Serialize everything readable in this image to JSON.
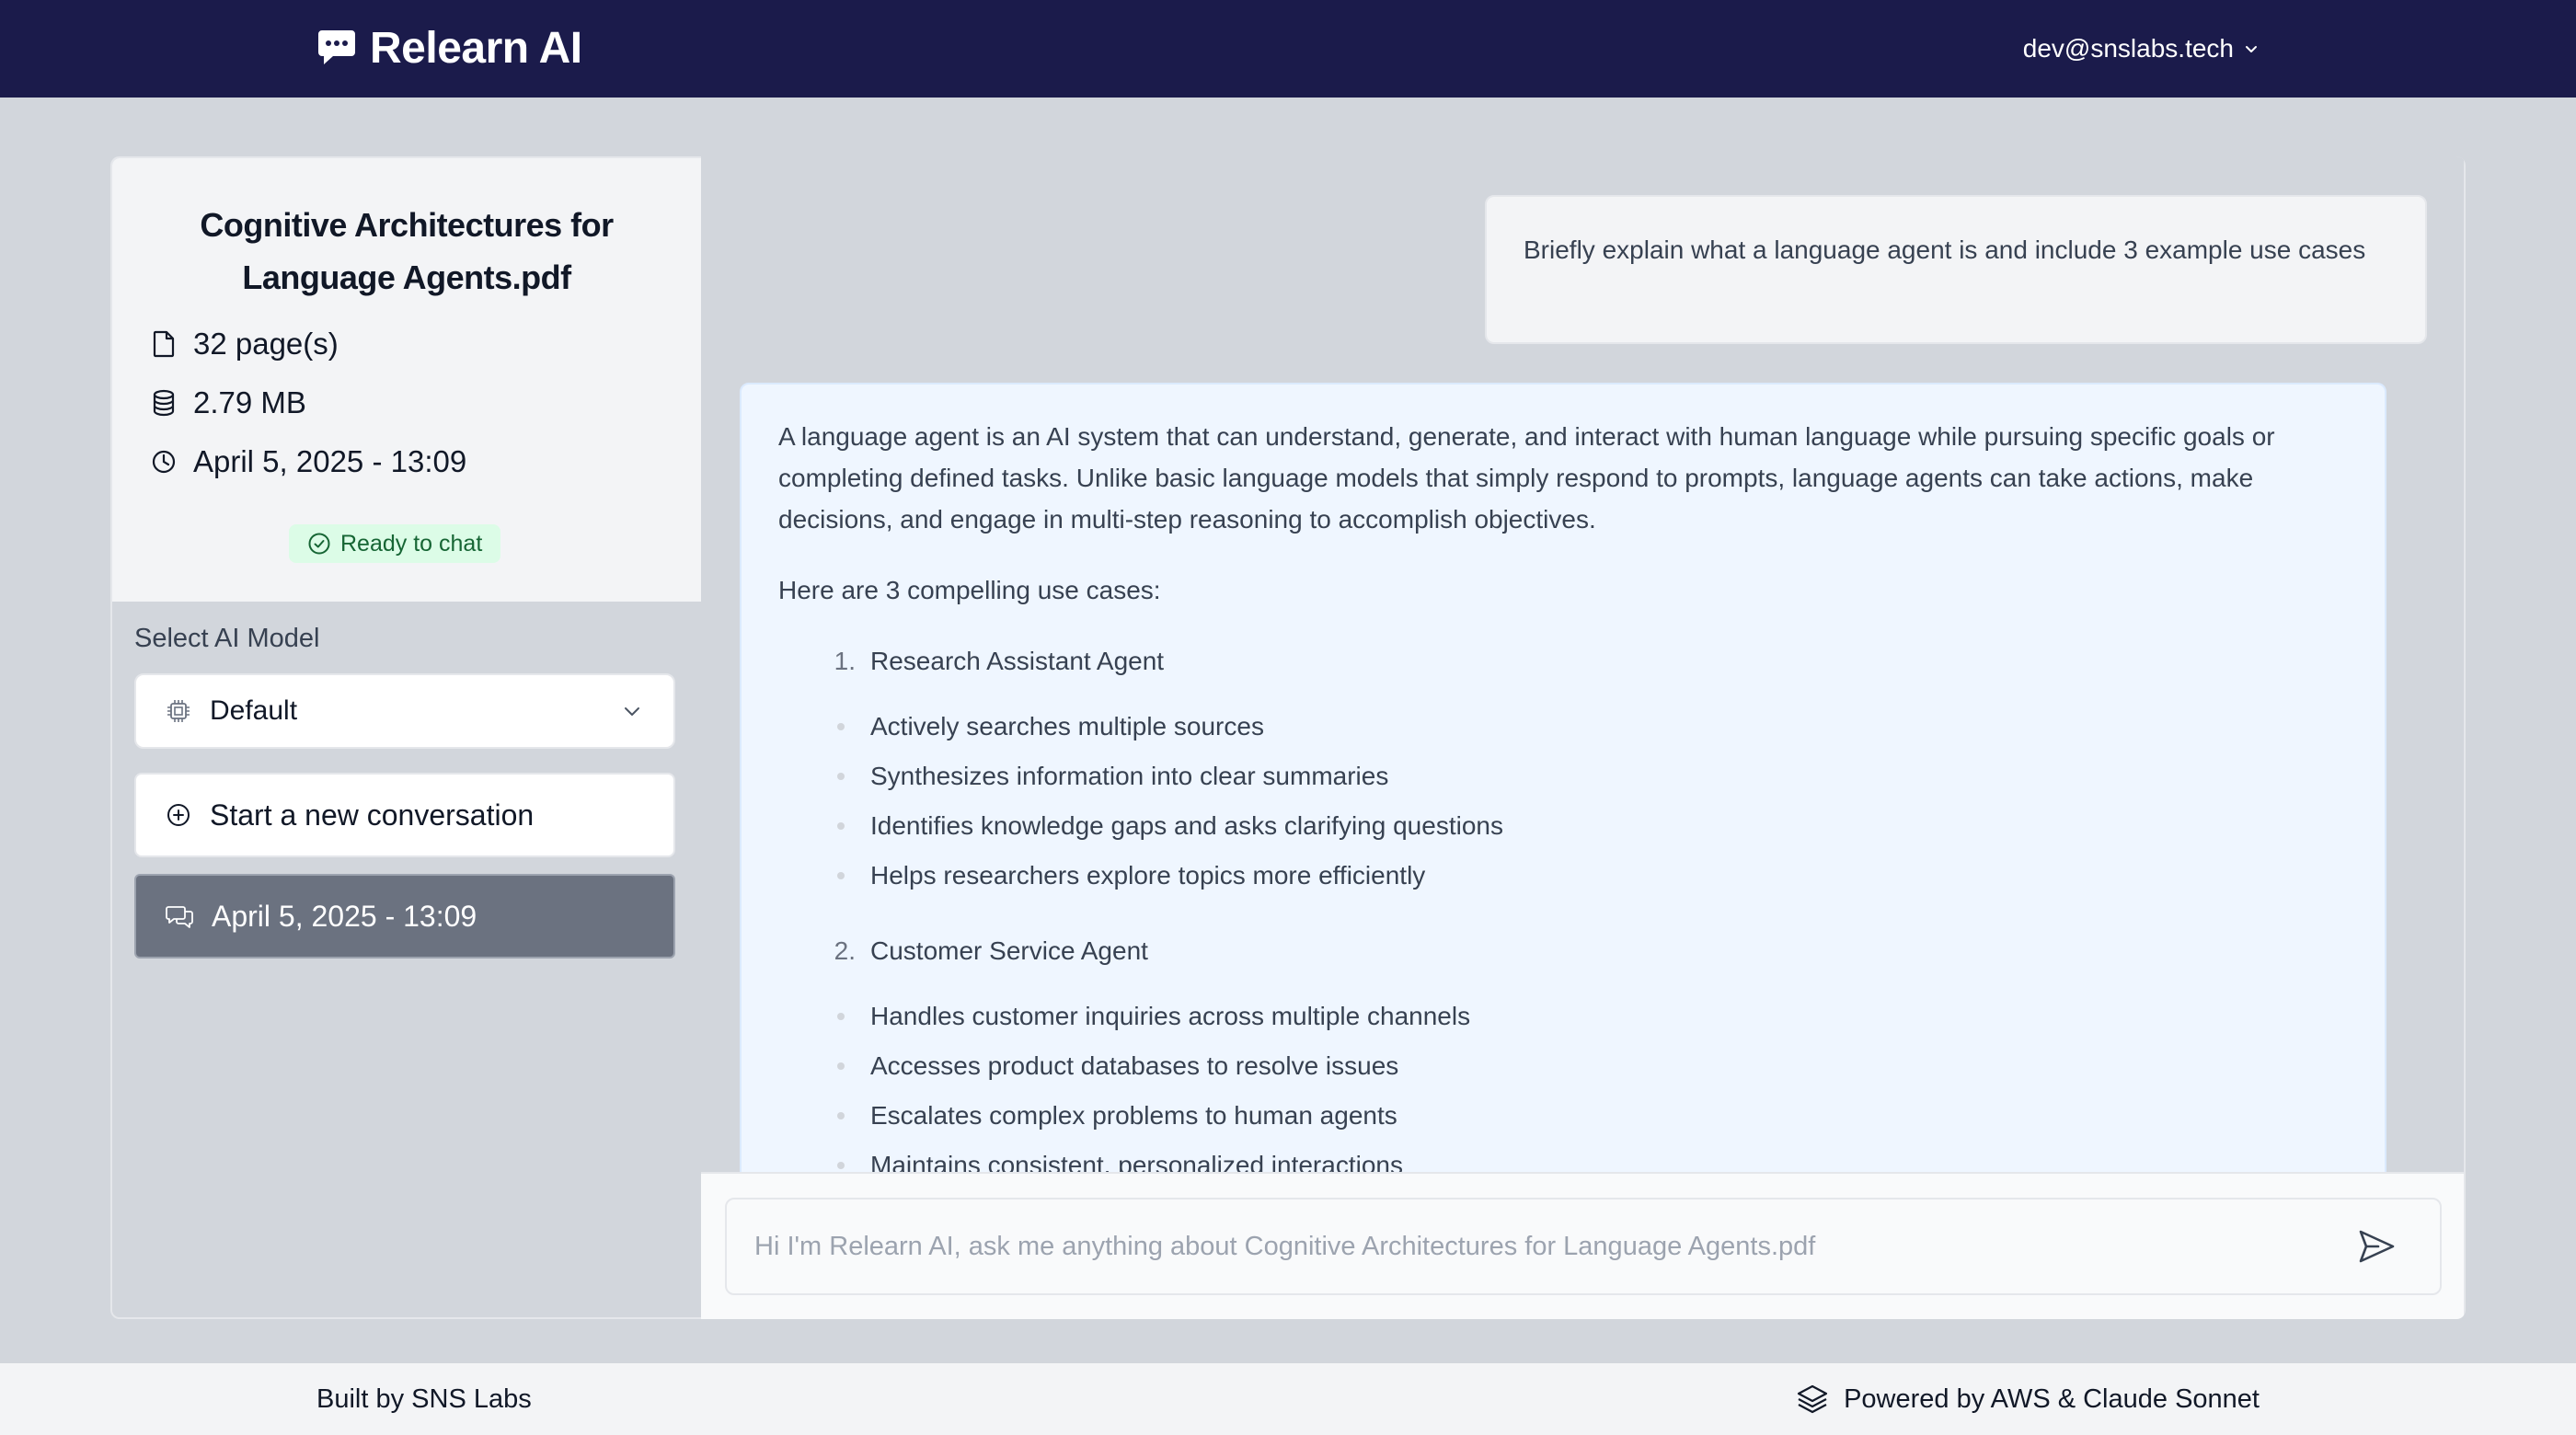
{
  "header": {
    "brand": "Relearn AI",
    "user_email": "dev@snslabs.tech"
  },
  "document": {
    "title": "Cognitive Architectures for Language Agents.pdf",
    "pages": "32 page(s)",
    "size": "2.79 MB",
    "date": "April 5, 2025 - 13:09",
    "status": "Ready to chat"
  },
  "model": {
    "label": "Select AI Model",
    "selected": "Default"
  },
  "conversations": {
    "new_label": "Start a new conversation",
    "items": [
      {
        "label": "April 5, 2025 - 13:09",
        "active": true
      }
    ]
  },
  "chat": {
    "user_message": "Briefly explain what a language agent is and include 3 example use cases",
    "ai_message": {
      "intro_paragraph": "A language agent is an AI system that can understand, generate, and interact with human language while pursuing specific goals or completing defined tasks. Unlike basic language models that simply respond to prompts, language agents can take actions, make decisions, and engage in multi-step reasoning to accomplish objectives.",
      "use_cases_intro": "Here are 3 compelling use cases:",
      "use_cases": [
        {
          "number": "1.",
          "title": "Research Assistant Agent",
          "points": [
            "Actively searches multiple sources",
            "Synthesizes information into clear summaries",
            "Identifies knowledge gaps and asks clarifying questions",
            "Helps researchers explore topics more efficiently"
          ]
        },
        {
          "number": "2.",
          "title": "Customer Service Agent",
          "points": [
            "Handles customer inquiries across multiple channels",
            "Accesses product databases to resolve issues",
            "Escalates complex problems to human agents",
            "Maintains consistent, personalized interactions"
          ]
        }
      ]
    },
    "input_placeholder": "Hi I'm Relearn AI, ask me anything about Cognitive Architectures for Language Agents.pdf",
    "input_value": ""
  },
  "footer": {
    "left": "Built by SNS Labs",
    "right": "Powered by AWS & Claude Sonnet"
  },
  "colors": {
    "header_bg": "#1b1b4b",
    "page_bg": "#d2d6dc",
    "ai_bubble_bg": "#eff6ff",
    "ready_badge_bg": "#dcfce7",
    "ready_badge_text": "#166534",
    "active_conversation_bg": "#6b7280"
  },
  "icons": {
    "brand": "chat-bubble-icon",
    "user_menu": "chevron-down-icon",
    "pages": "file-icon",
    "size": "database-icon",
    "date": "clock-icon",
    "status": "check-circle-icon",
    "model": "cpu-icon",
    "new_conversation": "plus-circle-icon",
    "conversation": "messages-icon",
    "send": "send-icon",
    "powered": "layers-icon"
  }
}
